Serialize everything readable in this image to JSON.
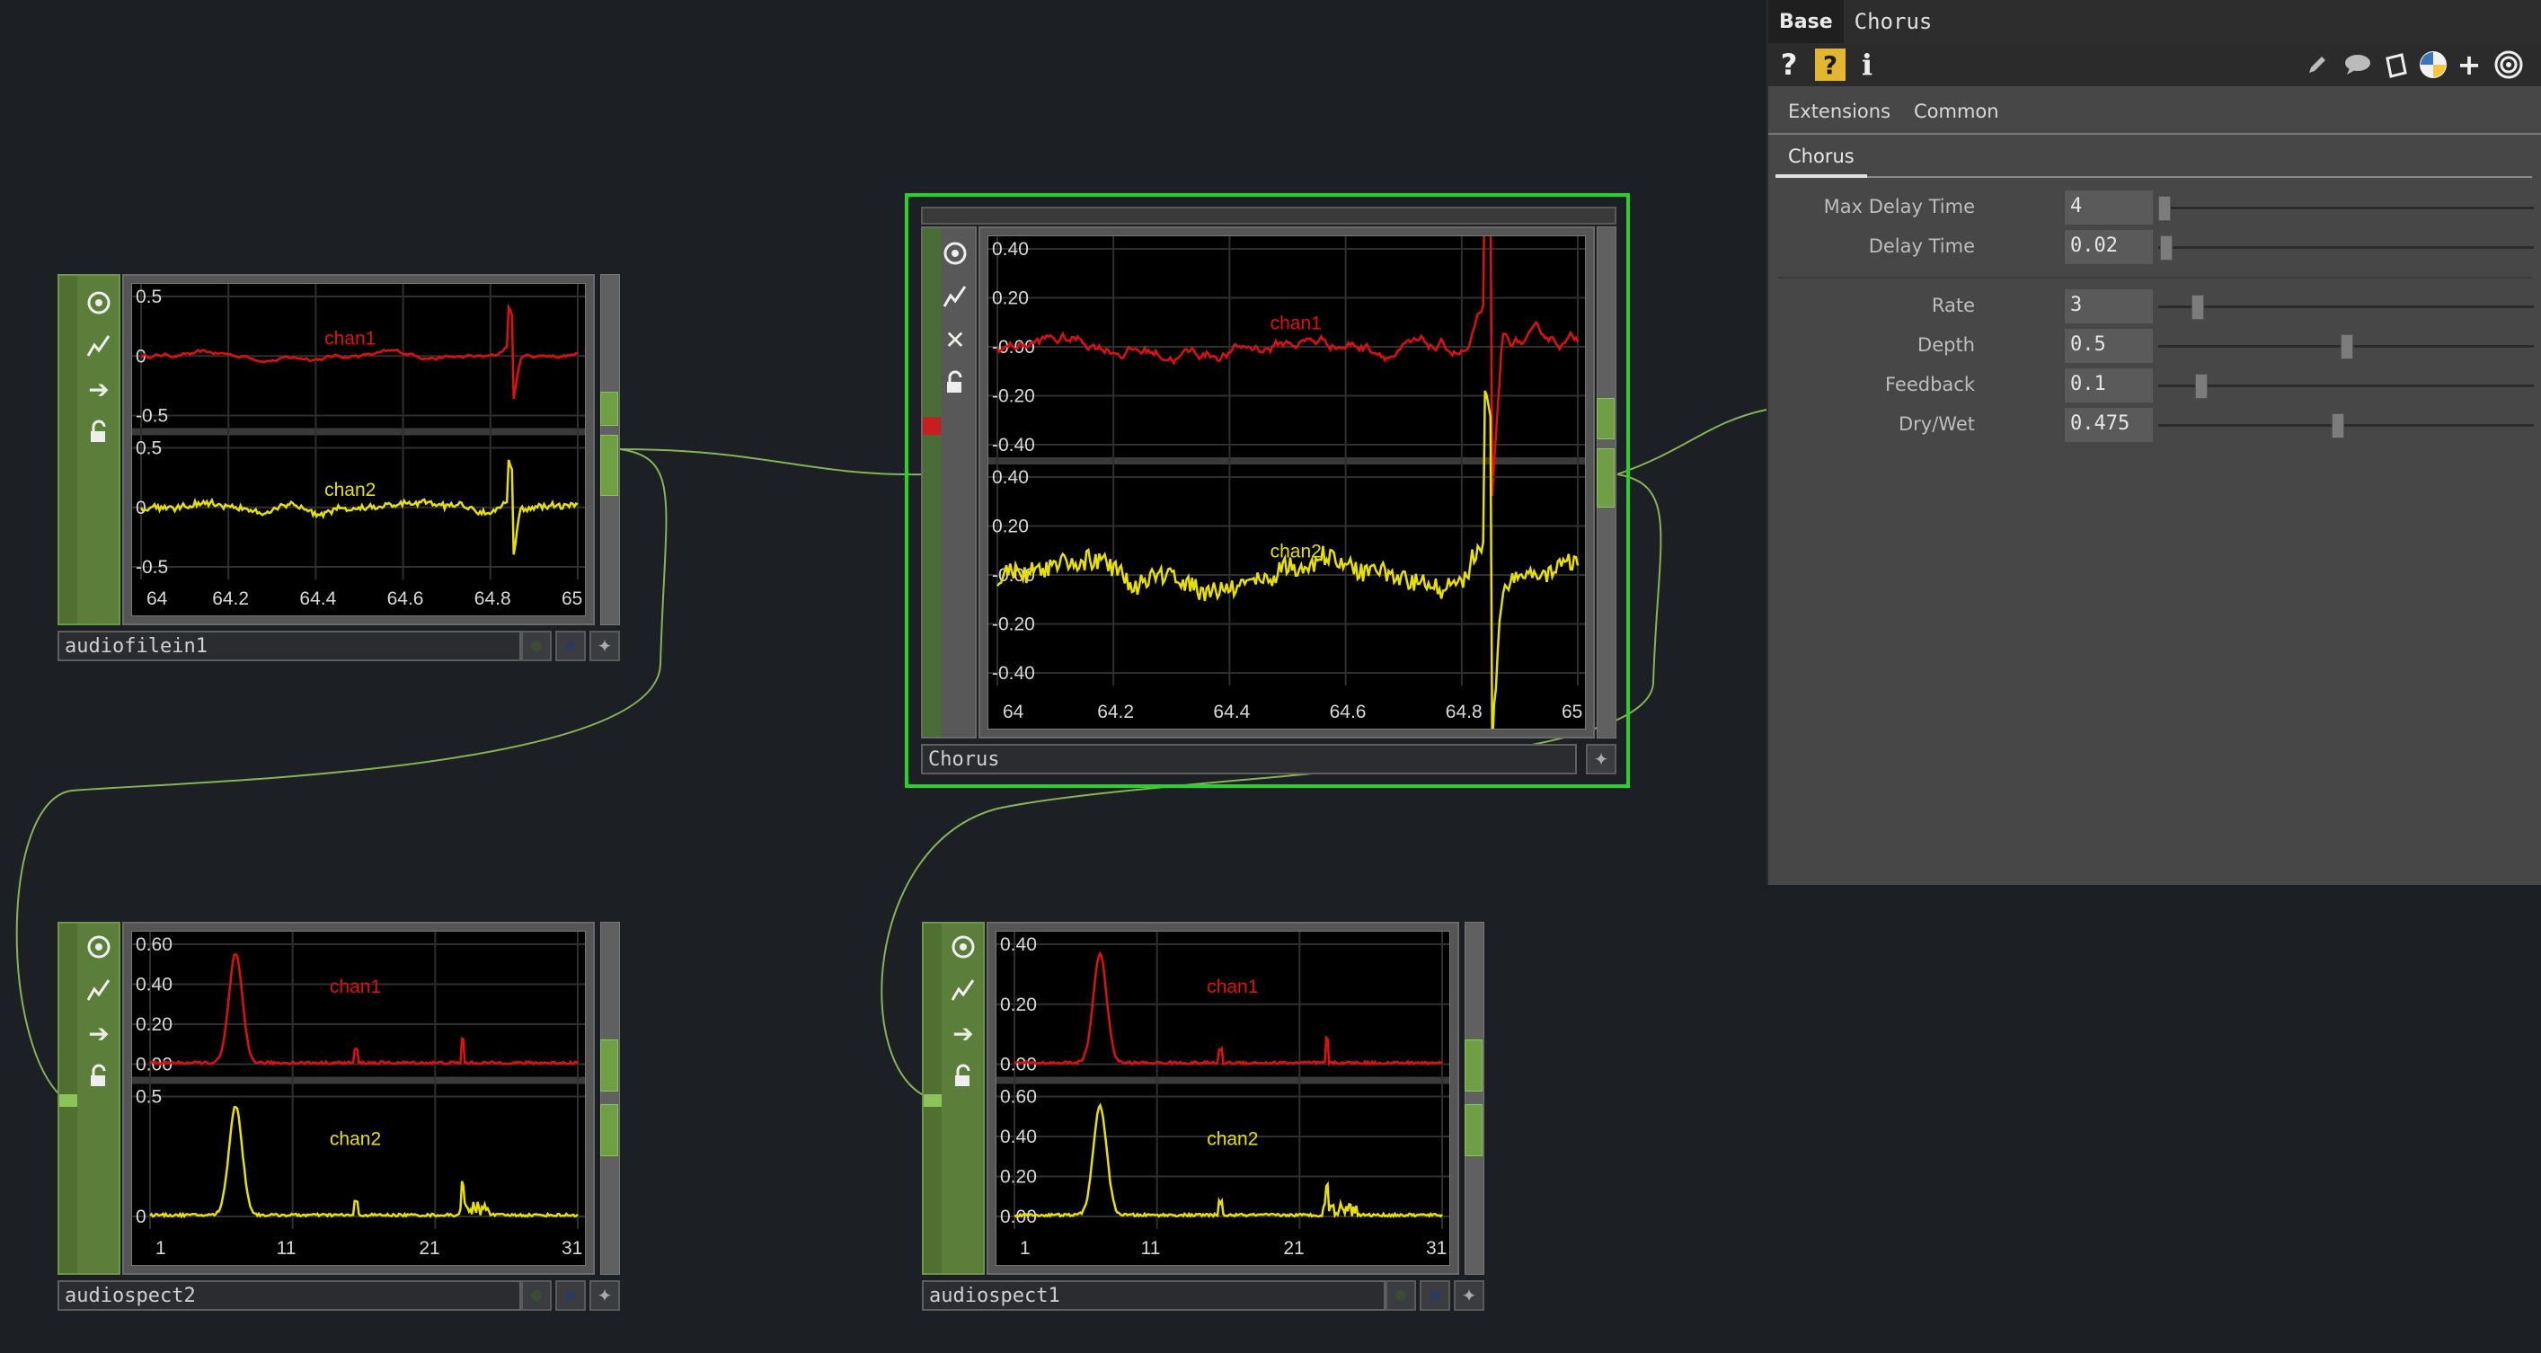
{
  "panel": {
    "type_label": "Base",
    "op_name": "Chorus",
    "toolbar_help": "?",
    "toolbar_help2": "?",
    "toolbar_info": "i",
    "tabs": [
      "Extensions",
      "Common"
    ],
    "active_subtab": "Chorus",
    "params": [
      {
        "label": "Max Delay Time",
        "value": "4",
        "level": 0.0
      },
      {
        "label": "Delay Time",
        "value": "0.02",
        "level": 0.005
      },
      {
        "label": "Rate",
        "value": "3",
        "level": 0.09
      },
      {
        "label": "Depth",
        "value": "0.5",
        "level": 0.5
      },
      {
        "label": "Feedback",
        "value": "0.1",
        "level": 0.1
      },
      {
        "label": "Dry/Wet",
        "value": "0.475",
        "level": 0.475
      }
    ]
  },
  "nodes": {
    "audiofilein1": {
      "name": "audiofilein1",
      "chan1_label": "chan1",
      "chan2_label": "chan2",
      "y_ticks_top": [
        "0.5",
        "0",
        "-0.5"
      ],
      "y_ticks_bottom": [
        "0.5",
        "0",
        "-0.5"
      ],
      "x_ticks": [
        "64",
        "64.2",
        "64.4",
        "64.6",
        "64.8",
        "65"
      ]
    },
    "chorus": {
      "name": "Chorus",
      "chan1_label": "chan1",
      "chan2_label": "chan2",
      "y_ticks_top": [
        "0.40",
        "0.20",
        "-0.00",
        "-0.20",
        "-0.40"
      ],
      "y_ticks_bottom": [
        "0.40",
        "0.20",
        "-0.00",
        "-0.20",
        "-0.40"
      ],
      "x_ticks": [
        "64",
        "64.2",
        "64.4",
        "64.6",
        "64.8",
        "65"
      ]
    },
    "audiospect2": {
      "name": "audiospect2",
      "chan1_label": "chan1",
      "chan2_label": "chan2",
      "y_ticks_top": [
        "0.60",
        "0.40",
        "0.20",
        "0.00"
      ],
      "y_ticks_bottom": [
        "0.5",
        "0"
      ],
      "x_ticks": [
        "1",
        "11",
        "21",
        "31"
      ]
    },
    "audiospect1": {
      "name": "audiospect1",
      "chan1_label": "chan1",
      "chan2_label": "chan2",
      "y_ticks_top": [
        "0.40",
        "0.20",
        "0.00"
      ],
      "y_ticks_bottom": [
        "0.60",
        "0.40",
        "0.20",
        "0.00"
      ],
      "x_ticks": [
        "1",
        "11",
        "21",
        "31"
      ]
    }
  },
  "colors": {
    "chan1": "#e01010",
    "chan2": "#e8e000",
    "selected": "#27d32a",
    "wire": "#8fbe5a"
  }
}
